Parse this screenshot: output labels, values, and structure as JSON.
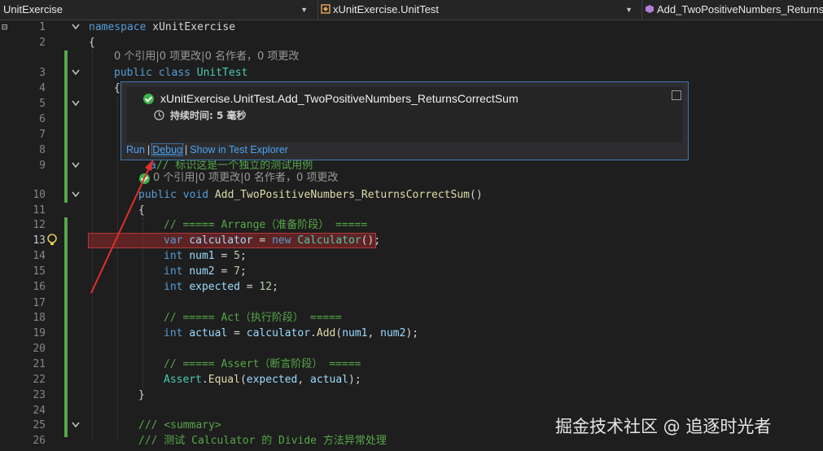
{
  "navbar": {
    "project": "UnitExercise",
    "type": "xUnitExercise.UnitTest",
    "member": "Add_TwoPositiveNumbers_Returns"
  },
  "line_numbers": [
    "1",
    "2",
    "3",
    "4",
    "5",
    "6",
    "7",
    "8",
    "9",
    "10",
    "11",
    "12",
    "13",
    "14",
    "15",
    "16",
    "17",
    "18",
    "19",
    "20",
    "21",
    "22",
    "23",
    "24",
    "25",
    "26"
  ],
  "active_line": "13",
  "codelens": {
    "class_refs": "0 个引用|0 项更改|0 名作者，0 项更改",
    "method_refs": "0 个引用|0 项更改|0 名作者，0 项更改"
  },
  "code": {
    "l1_kw": "namespace",
    "l1_ns": "xUnitExercise",
    "l2": "{",
    "l3_kw": "public class",
    "l3_ty": "UnitTest",
    "l4": "{",
    "l9_frag1": "a",
    "l9_comment": "// 标识这是一个独立的测试用例",
    "l10_kw": "public void",
    "l10_fn": "Add_TwoPositiveNumbers_ReturnsCorrectSum",
    "l10_paren": "()",
    "l11": "{",
    "l12": "// ===== Arrange（准备阶段） =====",
    "l13_kw": "var",
    "l13_var": "calculator",
    "l13_eq": " = ",
    "l13_new": "new",
    "l13_ty": "Calculator",
    "l13_end": "();",
    "l14_kw": "int",
    "l14_var": "num1",
    "l14_eq": " = ",
    "l14_num": "5",
    "l14_end": ";",
    "l15_kw": "int",
    "l15_var": "num2",
    "l15_eq": " = ",
    "l15_num": "7",
    "l15_end": ";",
    "l16_kw": "int",
    "l16_var": "expected",
    "l16_eq": " = ",
    "l16_num": "12",
    "l16_end": ";",
    "l18": "// ===== Act（执行阶段） =====",
    "l19_kw": "int",
    "l19_var": "actual",
    "l19_eq": " = ",
    "l19_obj": "calculator",
    "l19_dot": ".",
    "l19_fn": "Add",
    "l19_args1": "(",
    "l19_a1": "num1",
    "l19_comma": ", ",
    "l19_a2": "num2",
    "l19_end": ");",
    "l21": "// ===== Assert（断言阶段） =====",
    "l22_ty": "Assert",
    "l22_dot": ".",
    "l22_fn": "Equal",
    "l22_open": "(",
    "l22_a1": "expected",
    "l22_comma": ", ",
    "l22_a2": "actual",
    "l22_end": ");",
    "l23": "}",
    "l25": "/// <summary>",
    "l26": "/// 测试 Calculator 的 Divide 方法异常处理"
  },
  "popup": {
    "test_name": "xUnitExercise.UnitTest.Add_TwoPositiveNumbers_ReturnsCorrectSum",
    "duration": "持续时间: 5 毫秒",
    "run": "Run",
    "debug": "Debug",
    "show": "Show in Test Explorer",
    "sep": "|"
  },
  "watermark": "掘金技术社区 @ 追逐时光者",
  "colors": {
    "accent": "#3e76b0",
    "pass": "#3fb24a",
    "change_bar": "#57a64a",
    "arrow": "#e03030"
  }
}
